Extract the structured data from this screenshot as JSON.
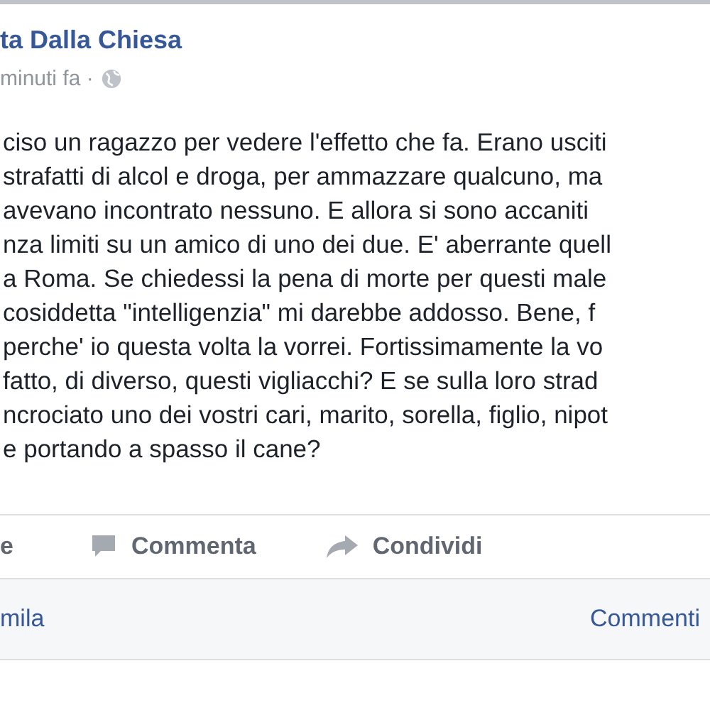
{
  "post": {
    "author": "ta Dalla Chiesa",
    "time": "minuti fa ·",
    "lines": [
      "ciso un ragazzo per vedere l'effetto che fa. Erano usciti",
      "strafatti di alcol e droga, per ammazzare qualcuno, ma",
      "avevano incontrato nessuno. E allora si sono accaniti",
      "nza limiti su un amico di uno dei due. E' aberrante quell",
      "a Roma. Se chiedessi la pena di morte per questi male",
      "cosiddetta \"intelligenzia\" mi darebbe addosso. Bene, f",
      "perche' io questa volta la vorrei. Fortissimamente la vo",
      "fatto, di diverso, questi vigliacchi? E se sulla loro strad",
      "ncrociato uno dei vostri cari, marito, sorella, figlio, nipot",
      "e portando a spasso il cane?"
    ]
  },
  "actions": [
    {
      "kind": "like",
      "label": "e"
    },
    {
      "kind": "comment",
      "label": "Commenta"
    },
    {
      "kind": "share",
      "label": "Condividi"
    }
  ],
  "footer": {
    "left": "mila",
    "right": "Commenti"
  }
}
